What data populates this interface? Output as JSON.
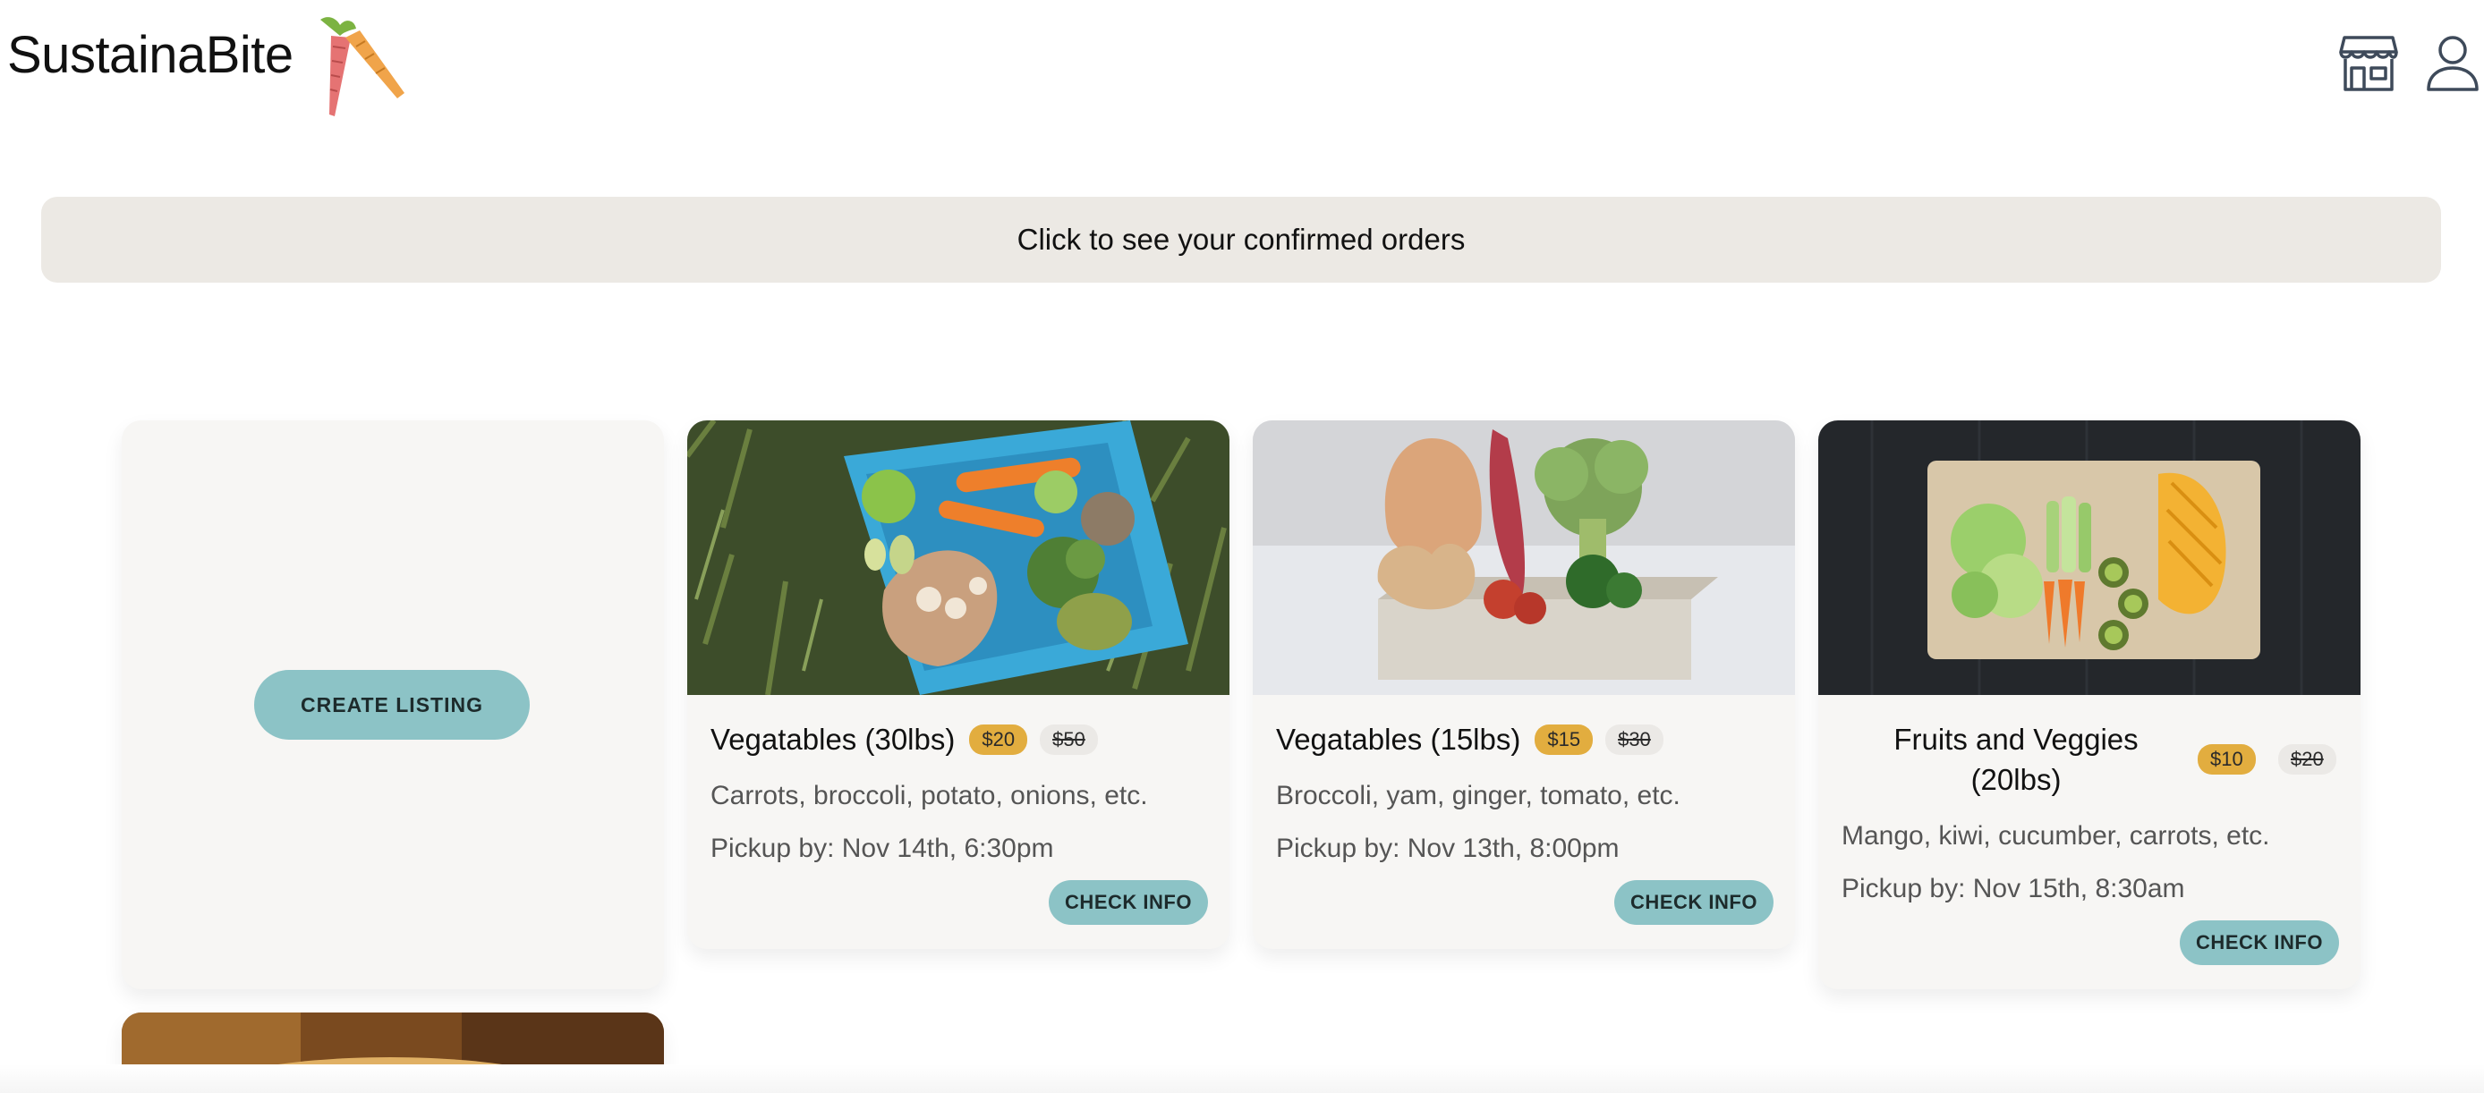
{
  "header": {
    "brand": "SustainaBite",
    "logo_icon": "carrot-logo-icon",
    "store_icon": "store-icon",
    "profile_icon": "user-profile-icon"
  },
  "banner": {
    "label": "Click to see your confirmed orders"
  },
  "create_card": {
    "button_label": "CREATE LISTING"
  },
  "listings": [
    {
      "title": "Vegatables (30lbs)",
      "price": "$20",
      "original_price": "$50",
      "description": "Carrots, broccoli, potato, onions, etc.",
      "pickup": "Pickup by: Nov 14th, 6:30pm",
      "button_label": "CHECK INFO"
    },
    {
      "title": "Vegatables (15lbs)",
      "price": "$15",
      "original_price": "$30",
      "description": "Broccoli, yam, ginger, tomato, etc.",
      "pickup": "Pickup by: Nov 13th, 8:00pm",
      "button_label": "CHECK INFO"
    },
    {
      "title_line1": "Fruits and Veggies",
      "title_line2": "(20lbs)",
      "price": "$10",
      "original_price": "$20",
      "description": "Mango, kiwi, cucumber, carrots, etc.",
      "pickup": "Pickup by: Nov 15th, 8:30am",
      "button_label": "CHECK INFO"
    }
  ],
  "colors": {
    "accent_button": "#8cc3c6",
    "price_badge": "#e2ad3f",
    "banner_bg": "#ece9e4",
    "card_bg": "#f7f6f4"
  }
}
